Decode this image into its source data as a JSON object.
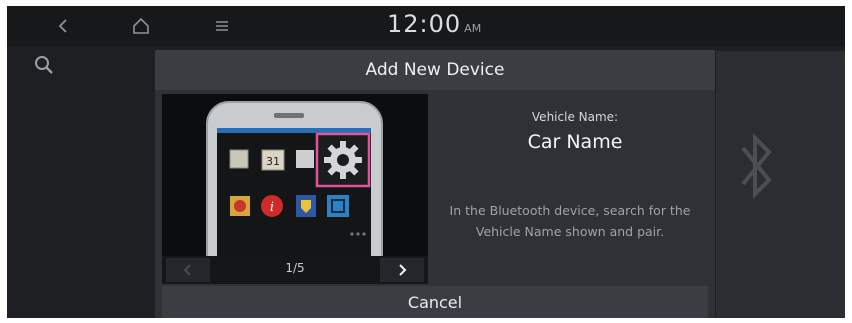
{
  "status_bar": {
    "time": "12:00",
    "ampm": "AM",
    "icons": [
      "back-chevron-icon",
      "home-icon",
      "menu-icon"
    ]
  },
  "side": {
    "search_icon": "search-icon",
    "bluetooth_icon": "bluetooth-icon"
  },
  "dialog": {
    "title": "Add New Device",
    "vehicle_name_label": "Vehicle Name:",
    "vehicle_name_value": "Car Name",
    "instruction": "In the Bluetooth device, search for the Vehicle Name shown and pair.",
    "cancel_label": "Cancel"
  },
  "illustration": {
    "page_indicator": "1/5",
    "calendar_day": "31",
    "highlight_color": "#e0559a",
    "prev_icon": "chevron-left-icon",
    "next_icon": "chevron-right-icon"
  }
}
